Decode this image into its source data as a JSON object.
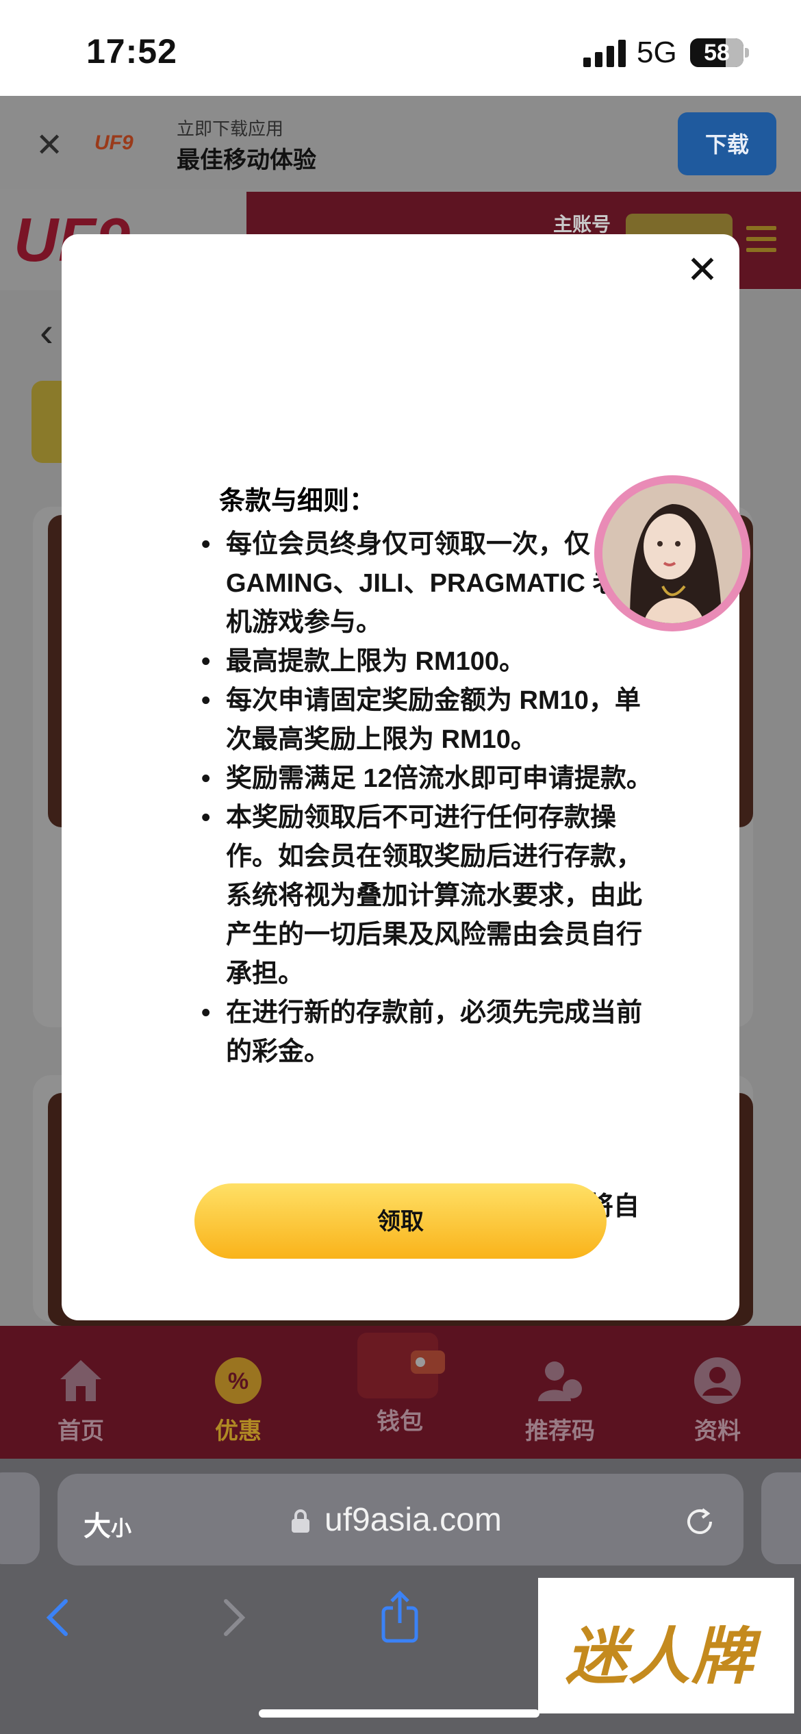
{
  "status_bar": {
    "time": "17:52",
    "network": "5G",
    "battery": "58"
  },
  "download_banner": {
    "close": "✕",
    "logo": "UF9",
    "subtitle": "立即下载应用",
    "title": "最佳移动体验",
    "button": "下载"
  },
  "header": {
    "logo": "UF9",
    "account_label": "主账号"
  },
  "modal": {
    "close": "✕",
    "terms_title": "条款与细则：",
    "terms": [
      "每位会员终身仅可领取一次，仅 AI GAMING、JILI、PRAGMATIC 老虎机游戏参与。",
      "最高提款上限为 RM100。",
      "每次申请固定奖励金额为 RM10，单次最高奖励上限为 RM10。",
      "奖励需满足 12倍流水即可申请提款。",
      "本奖励领取后不可进行任何存款操作。如会员在领取奖励后进行存款，系统将视为叠加计算流水要求，由此产生的一切后果及风险需由会员自行承担。",
      "在进行新的存款前，必须先完成当前的彩金。"
    ],
    "trailing_text": "将自",
    "claim_button": "领取"
  },
  "tab_bar": {
    "items": [
      {
        "label": "首页",
        "icon": "home-icon"
      },
      {
        "label": "优惠",
        "icon": "promo-icon"
      },
      {
        "label": "钱包",
        "icon": "wallet-icon"
      },
      {
        "label": "推荐码",
        "icon": "referral-icon"
      },
      {
        "label": "资料",
        "icon": "profile-icon"
      }
    ],
    "active": "优惠"
  },
  "browser": {
    "text_size_big": "大",
    "text_size_small": "小",
    "url": "uf9asia.com"
  },
  "watermark": {
    "text": "迷人牌"
  }
}
